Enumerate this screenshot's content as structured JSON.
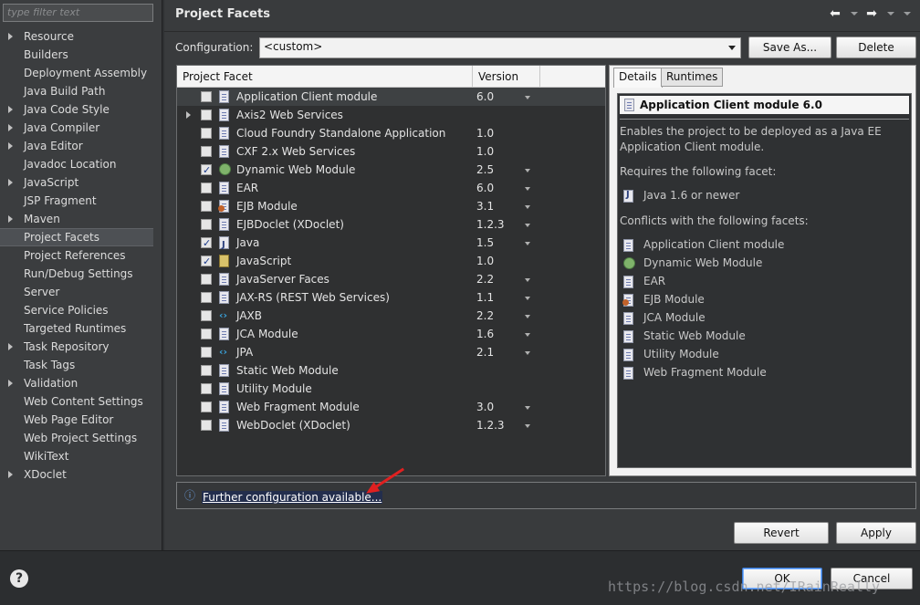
{
  "filter": {
    "placeholder": "type filter text"
  },
  "nav": {
    "items": [
      {
        "label": "Resource",
        "expandable": true
      },
      {
        "label": "Builders",
        "expandable": false
      },
      {
        "label": "Deployment Assembly",
        "expandable": false
      },
      {
        "label": "Java Build Path",
        "expandable": false
      },
      {
        "label": "Java Code Style",
        "expandable": true
      },
      {
        "label": "Java Compiler",
        "expandable": true
      },
      {
        "label": "Java Editor",
        "expandable": true
      },
      {
        "label": "Javadoc Location",
        "expandable": false
      },
      {
        "label": "JavaScript",
        "expandable": true
      },
      {
        "label": "JSP Fragment",
        "expandable": false
      },
      {
        "label": "Maven",
        "expandable": true
      },
      {
        "label": "Project Facets",
        "expandable": false,
        "selected": true
      },
      {
        "label": "Project References",
        "expandable": false
      },
      {
        "label": "Run/Debug Settings",
        "expandable": false
      },
      {
        "label": "Server",
        "expandable": false
      },
      {
        "label": "Service Policies",
        "expandable": false
      },
      {
        "label": "Targeted Runtimes",
        "expandable": false
      },
      {
        "label": "Task Repository",
        "expandable": true
      },
      {
        "label": "Task Tags",
        "expandable": false
      },
      {
        "label": "Validation",
        "expandable": true
      },
      {
        "label": "Web Content Settings",
        "expandable": false
      },
      {
        "label": "Web Page Editor",
        "expandable": false
      },
      {
        "label": "Web Project Settings",
        "expandable": false
      },
      {
        "label": "WikiText",
        "expandable": false
      },
      {
        "label": "XDoclet",
        "expandable": true
      }
    ]
  },
  "header": {
    "title": "Project Facets",
    "back_icon": "arrow-left-icon",
    "forward_icon": "arrow-right-icon"
  },
  "config": {
    "label": "Configuration:",
    "value": "<custom>",
    "save_as": "Save As...",
    "delete": "Delete"
  },
  "facets": {
    "col_facet": "Project Facet",
    "col_version": "Version",
    "rows": [
      {
        "name": "Application Client module",
        "version": "6.0",
        "checked": false,
        "icon": "doc",
        "dropdown": true,
        "selected": true
      },
      {
        "name": "Axis2 Web Services",
        "version": "",
        "checked": false,
        "icon": "doc",
        "expandable": true
      },
      {
        "name": "Cloud Foundry Standalone Application",
        "version": "1.0",
        "checked": false,
        "icon": "doc"
      },
      {
        "name": "CXF 2.x Web Services",
        "version": "1.0",
        "checked": false,
        "icon": "doc"
      },
      {
        "name": "Dynamic Web Module",
        "version": "2.5",
        "checked": true,
        "icon": "globe",
        "dropdown": true
      },
      {
        "name": "EAR",
        "version": "6.0",
        "checked": false,
        "icon": "doc",
        "dropdown": true
      },
      {
        "name": "EJB Module",
        "version": "3.1",
        "checked": false,
        "icon": "bean",
        "dropdown": true
      },
      {
        "name": "EJBDoclet (XDoclet)",
        "version": "1.2.3",
        "checked": false,
        "icon": "doc",
        "dropdown": true
      },
      {
        "name": "Java",
        "version": "1.5",
        "checked": true,
        "icon": "java",
        "dropdown": true
      },
      {
        "name": "JavaScript",
        "version": "1.0",
        "checked": true,
        "icon": "js"
      },
      {
        "name": "JavaServer Faces",
        "version": "2.2",
        "checked": false,
        "icon": "doc",
        "dropdown": true
      },
      {
        "name": "JAX-RS (REST Web Services)",
        "version": "1.1",
        "checked": false,
        "icon": "doc",
        "dropdown": true
      },
      {
        "name": "JAXB",
        "version": "2.2",
        "checked": false,
        "icon": "xml",
        "dropdown": true
      },
      {
        "name": "JCA Module",
        "version": "1.6",
        "checked": false,
        "icon": "doc",
        "dropdown": true
      },
      {
        "name": "JPA",
        "version": "2.1",
        "checked": false,
        "icon": "xml",
        "dropdown": true
      },
      {
        "name": "Static Web Module",
        "version": "",
        "checked": false,
        "icon": "doc"
      },
      {
        "name": "Utility Module",
        "version": "",
        "checked": false,
        "icon": "doc"
      },
      {
        "name": "Web Fragment Module",
        "version": "3.0",
        "checked": false,
        "icon": "doc",
        "dropdown": true
      },
      {
        "name": "WebDoclet (XDoclet)",
        "version": "1.2.3",
        "checked": false,
        "icon": "doc",
        "dropdown": true
      }
    ]
  },
  "details": {
    "tab_details": "Details",
    "tab_runtimes": "Runtimes",
    "heading": "Application Client module 6.0",
    "desc_line1": "Enables the project to be deployed as a Java EE",
    "desc_line2": "Application Client module.",
    "requires_label": "Requires the following facet:",
    "requires": [
      {
        "name": "Java 1.6 or newer",
        "icon": "java"
      }
    ],
    "conflicts_label": "Conflicts with the following facets:",
    "conflicts": [
      {
        "name": "Application Client module",
        "icon": "doc"
      },
      {
        "name": "Dynamic Web Module",
        "icon": "globe"
      },
      {
        "name": "EAR",
        "icon": "doc"
      },
      {
        "name": "EJB Module",
        "icon": "bean"
      },
      {
        "name": "JCA Module",
        "icon": "doc"
      },
      {
        "name": "Static Web Module",
        "icon": "doc"
      },
      {
        "name": "Utility Module",
        "icon": "doc"
      },
      {
        "name": "Web Fragment Module",
        "icon": "doc"
      }
    ]
  },
  "further": {
    "link": "Further configuration available...",
    "icon": "info-icon"
  },
  "buttons": {
    "revert": "Revert",
    "apply": "Apply",
    "ok": "OK",
    "cancel": "Cancel"
  },
  "watermark": "https://blog.csdn.net/IRainReally",
  "colors": {
    "annotation_arrow": "#e02020",
    "link": "#ffffff",
    "checkmark": "#1b3a8c"
  }
}
